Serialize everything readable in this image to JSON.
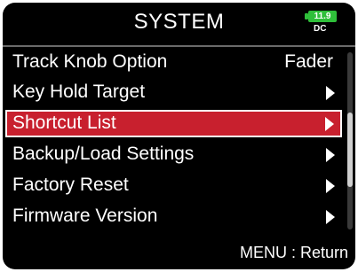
{
  "header": {
    "title": "SYSTEM",
    "battery": {
      "level": "11.9",
      "source": "DC",
      "color": "#2fbf3a"
    }
  },
  "menu": {
    "items": [
      {
        "label": "Track Knob Option",
        "value": "Fader",
        "has_arrow": false,
        "selected": false
      },
      {
        "label": "Key Hold Target",
        "value": "",
        "has_arrow": true,
        "selected": false
      },
      {
        "label": "Shortcut List",
        "value": "",
        "has_arrow": true,
        "selected": true
      },
      {
        "label": "Backup/Load Settings",
        "value": "",
        "has_arrow": true,
        "selected": false
      },
      {
        "label": "Factory Reset",
        "value": "",
        "has_arrow": true,
        "selected": false
      },
      {
        "label": "Firmware Version",
        "value": "",
        "has_arrow": true,
        "selected": false
      }
    ],
    "selected_color": "#c8202e"
  },
  "footer": {
    "hint": "MENU : Return"
  }
}
